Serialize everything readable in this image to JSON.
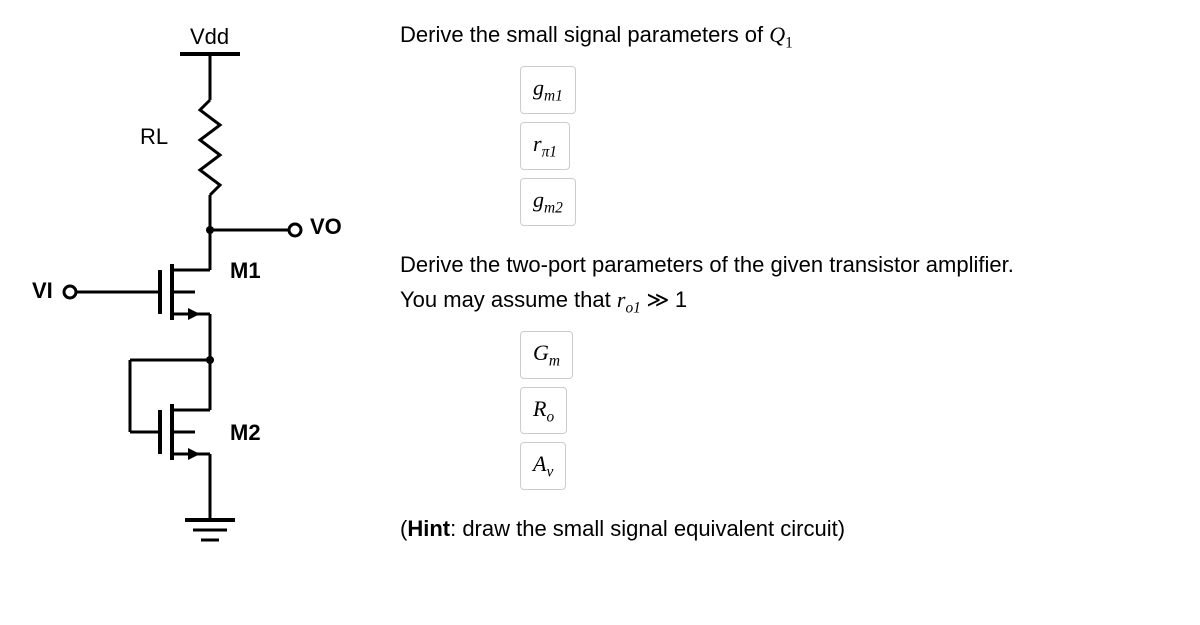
{
  "circuit": {
    "vdd": "Vdd",
    "rl": "RL",
    "vo": "VO",
    "vi": "VI",
    "m1": "M1",
    "m2": "M2"
  },
  "q1_prompt_prefix": "Derive the small signal parameters of ",
  "q1_symbol": "Q",
  "q1_sub": "1",
  "params1": {
    "gm1_base": "g",
    "gm1_sub": "m1",
    "rpi1_base": "r",
    "rpi1_sub": "π1",
    "gm2_base": "g",
    "gm2_sub": "m2"
  },
  "q2_line1": "Derive the two-port parameters of the given transistor amplifier.",
  "q2_line2_prefix": "You may assume that ",
  "q2_ro_base": "r",
  "q2_ro_sub": "o1",
  "q2_gg": " ≫ ",
  "q2_one": "1",
  "params2": {
    "gm_base": "G",
    "gm_sub": "m",
    "ro_base": "R",
    "ro_sub": "o",
    "av_base": "A",
    "av_sub": "v"
  },
  "hint_bold": "Hint",
  "hint_rest": ": draw the small signal equivalent circuit)"
}
